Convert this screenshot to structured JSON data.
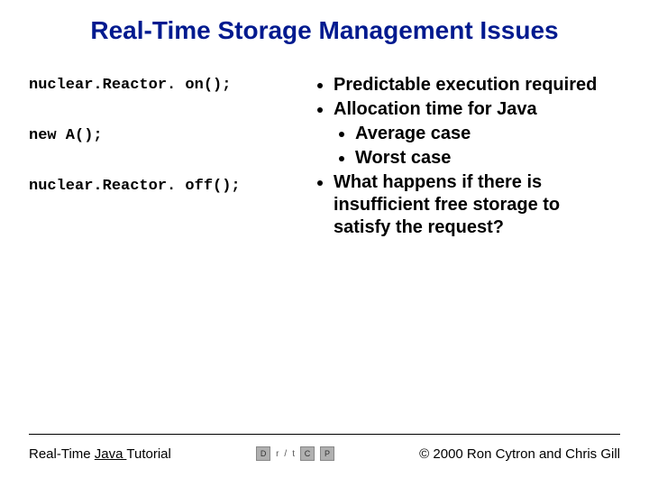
{
  "title": "Real-Time Storage Management Issues",
  "code": {
    "line1": "nuclear.Reactor. on();",
    "line2": "new A();",
    "line3": "nuclear.Reactor. off();"
  },
  "bullets": {
    "b1": "Predictable execution required",
    "b2": "Allocation time for Java",
    "b2a": "Average case",
    "b2b": "Worst case",
    "b3": "What happens if there is insufficient free storage to satisfy the request?"
  },
  "footer": {
    "left_prefix": "Real-Time ",
    "left_underlined": "Java ",
    "left_suffix": "Tutorial",
    "nav": {
      "d": "D",
      "r": "r",
      "t": "t",
      "c": "C",
      "p": "P"
    },
    "right": "© 2000 Ron Cytron and Chris Gill"
  }
}
